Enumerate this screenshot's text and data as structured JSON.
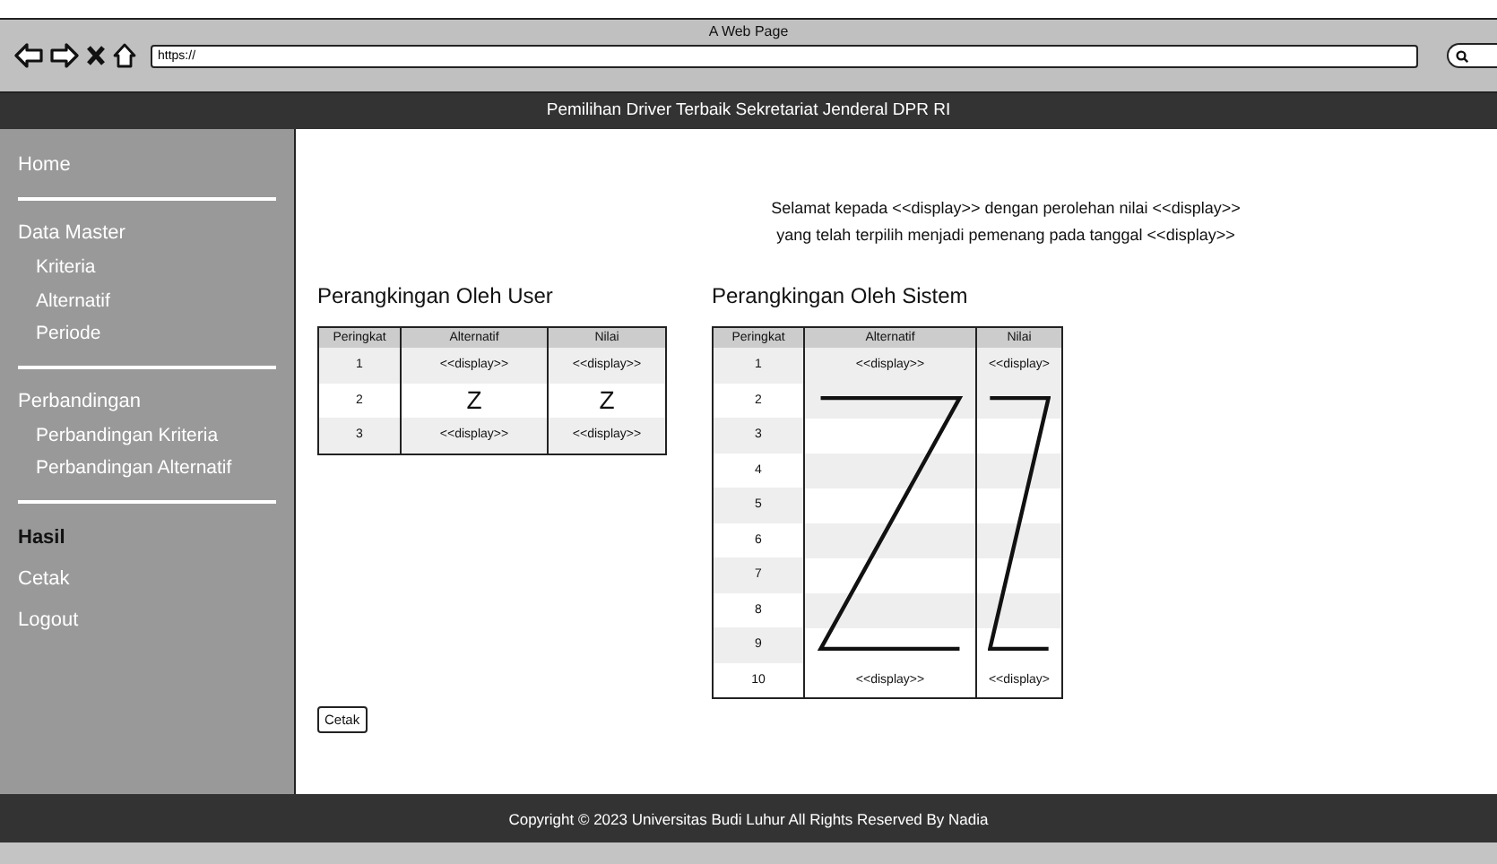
{
  "browser": {
    "title": "A Web Page",
    "url": "https://"
  },
  "header": {
    "title": "Pemilihan Driver Terbaik Sekretariat Jenderal DPR RI"
  },
  "sidebar": {
    "groups": [
      {
        "items": [
          {
            "label": "Home",
            "selected": false
          }
        ]
      },
      {
        "items": [
          {
            "label": "Data Master",
            "selected": false,
            "children": [
              {
                "label": "Kriteria",
                "selected": false
              },
              {
                "label": "Alternatif",
                "selected": false
              },
              {
                "label": "Periode",
                "selected": false
              }
            ]
          }
        ]
      },
      {
        "items": [
          {
            "label": "Perbandingan",
            "selected": false,
            "children": [
              {
                "label": "Perbandingan Kriteria",
                "selected": false
              },
              {
                "label": "Perbandingan Alternatif",
                "selected": false
              }
            ]
          }
        ]
      },
      {
        "items": [
          {
            "label": "Hasil",
            "selected": true
          },
          {
            "label": "Cetak",
            "selected": false
          },
          {
            "label": "Logout",
            "selected": false
          }
        ]
      }
    ]
  },
  "message": "Selamat kepada <<display>> dengan perolehan nilai <<display>>\nyang telah terpilih menjadi pemenang pada tanggal <<display>>",
  "user_ranking": {
    "title": "Perangkingan Oleh User",
    "columns": [
      "Peringkat",
      "Alternatif",
      "Nilai"
    ],
    "rows": [
      {
        "kind": "values",
        "rank": "1",
        "alternatif": "<<display>>",
        "nilai": "<<display>>"
      },
      {
        "kind": "values",
        "rank": "2",
        "alternatif": "Z",
        "nilai": "Z"
      },
      {
        "kind": "values",
        "rank": "3",
        "alternatif": "<<display>>",
        "nilai": "<<display>>"
      }
    ]
  },
  "system_ranking": {
    "title": "Perangkingan Oleh Sistem",
    "columns": [
      "Peringkat",
      "Alternatif",
      "Nilai"
    ],
    "rows": [
      {
        "kind": "values",
        "rank": "1",
        "alternatif": "<<display>>",
        "nilai": "<<display>"
      },
      {
        "kind": "placeholder",
        "rank": "2"
      },
      {
        "kind": "placeholder",
        "rank": "3"
      },
      {
        "kind": "placeholder",
        "rank": "4"
      },
      {
        "kind": "placeholder",
        "rank": "5"
      },
      {
        "kind": "placeholder",
        "rank": "6"
      },
      {
        "kind": "placeholder",
        "rank": "7"
      },
      {
        "kind": "placeholder",
        "rank": "8"
      },
      {
        "kind": "placeholder",
        "rank": "9"
      },
      {
        "kind": "values",
        "rank": "10",
        "alternatif": "<<display>>",
        "nilai": "<<display>"
      }
    ]
  },
  "print_button": "Cetak",
  "footer": "Copyright © 2023 Universitas Budi Luhur All Rights Reserved By Nadia"
}
